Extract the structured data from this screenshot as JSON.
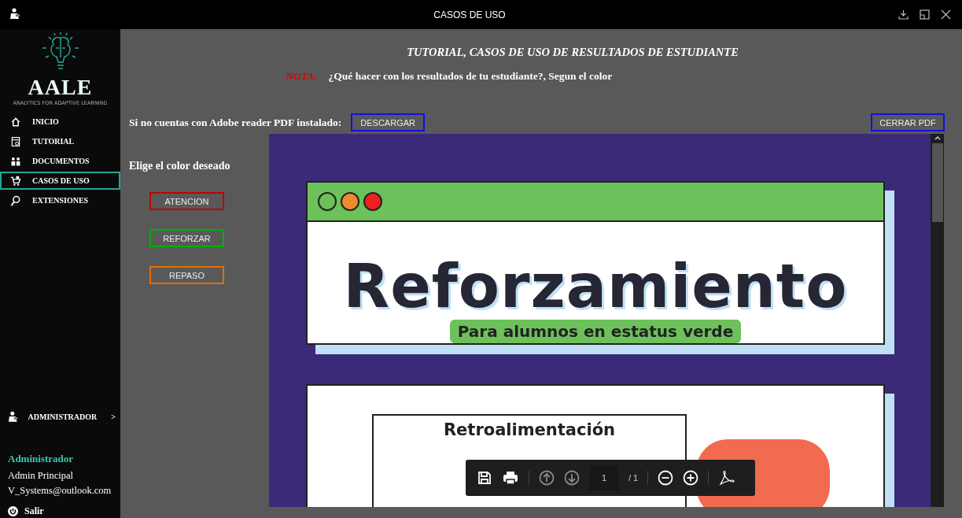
{
  "window": {
    "title": "CASOS DE USO"
  },
  "sidebar": {
    "logo_text": "AALE",
    "logo_subtitle": "ANALYTICS FOR ADAPTIVE LEARNING",
    "items": [
      {
        "label": "INICIO",
        "selected": false
      },
      {
        "label": "TUTORIAL",
        "selected": false
      },
      {
        "label": "DOCUMENTOS",
        "selected": false
      },
      {
        "label": "CASOS DE USO",
        "selected": true
      },
      {
        "label": "EXTENSIONES",
        "selected": false
      }
    ],
    "admin_menu": {
      "label": "ADMINISTRADOR",
      "chevron": ">"
    },
    "user": {
      "role": "Administrador",
      "name": "Admin Principal",
      "email": "V_Systems@outlook.com"
    },
    "logout": "Salir"
  },
  "main": {
    "heading": "TUTORIAL, CASOS DE USO DE RESULTADOS DE ESTUDIANTE",
    "note": {
      "label": "NOTA:",
      "text": "¿Qué hacer con los resultados de tu estudiante?, Segun el color"
    },
    "download": {
      "text": "Si no cuentas con Adobe reader PDF instalado:",
      "button": "DESCARGAR"
    },
    "close_button": "CERRAR PDF",
    "color_prompt": "Elige el color deseado",
    "color_buttons": [
      {
        "label": "ATENCION",
        "color": "#c00000"
      },
      {
        "label": "REFORZAR",
        "color": "#00b000"
      },
      {
        "label": "REPASO",
        "color": "#e07000"
      }
    ],
    "pdf": {
      "slide_title": "Reforzamiento",
      "slide_subtitle": "Para alumnos en estatus verde",
      "next_slide_title": "Retroalimentación",
      "toolbar": {
        "page": "1",
        "total": "/ 1"
      }
    }
  }
}
